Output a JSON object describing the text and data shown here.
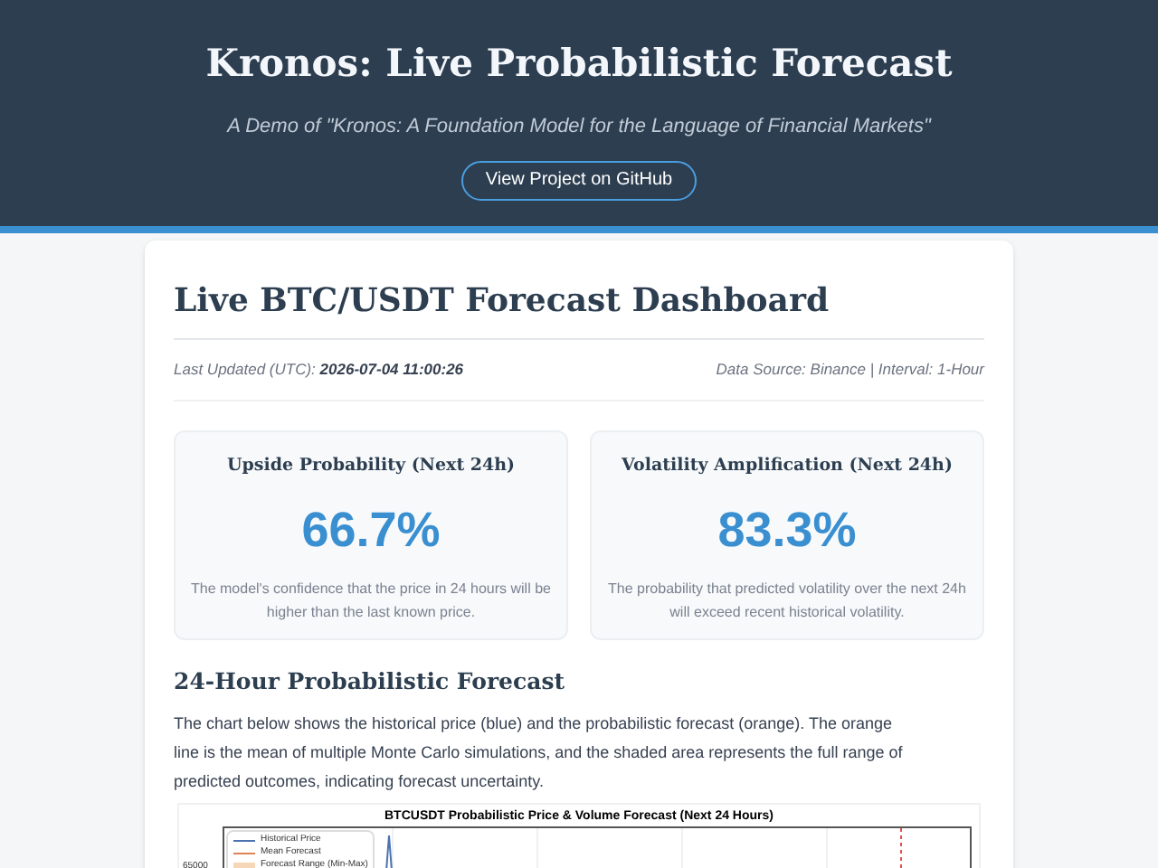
{
  "header": {
    "title": "Kronos: Live Probabilistic Forecast",
    "subtitle": "A Demo of \"Kronos: A Foundation Model for the Language of Financial Markets\"",
    "button": "View Project on GitHub"
  },
  "dashboard": {
    "title": "Live BTC/USDT Forecast Dashboard",
    "updated_label": "Last Updated (UTC):",
    "updated_value": "2026-07-04 11:00:26",
    "source": "Data Source: Binance | Interval: 1-Hour"
  },
  "metrics": [
    {
      "title": "Upside Probability (Next 24h)",
      "value": "66.7%",
      "description": "The model's confidence that the price in 24 hours will be higher than the last known price."
    },
    {
      "title": "Volatility Amplification (Next 24h)",
      "value": "83.3%",
      "description": "The probability that predicted volatility over the next 24h will exceed recent historical volatility."
    }
  ],
  "forecast": {
    "title": "24-Hour Probabilistic Forecast",
    "description": "The chart below shows the historical price (blue) and the probabilistic forecast (orange). The orange line is the mean of multiple Monte Carlo simulations, and the shaded area represents the full range of predicted outcomes, indicating forecast uncertainty.",
    "chart": {
      "title": "BTCUSDT Probabilistic Price & Volume Forecast (Next 24 Hours)",
      "legend": [
        {
          "label": "Historical Price",
          "kind": "line",
          "color": "#4c72b0"
        },
        {
          "label": "Mean Forecast",
          "kind": "line",
          "color": "#dd8452"
        },
        {
          "label": "Forecast Range (Min-Max)",
          "kind": "area",
          "color": "#f6d7b8"
        }
      ],
      "ytick": "65000"
    }
  }
}
